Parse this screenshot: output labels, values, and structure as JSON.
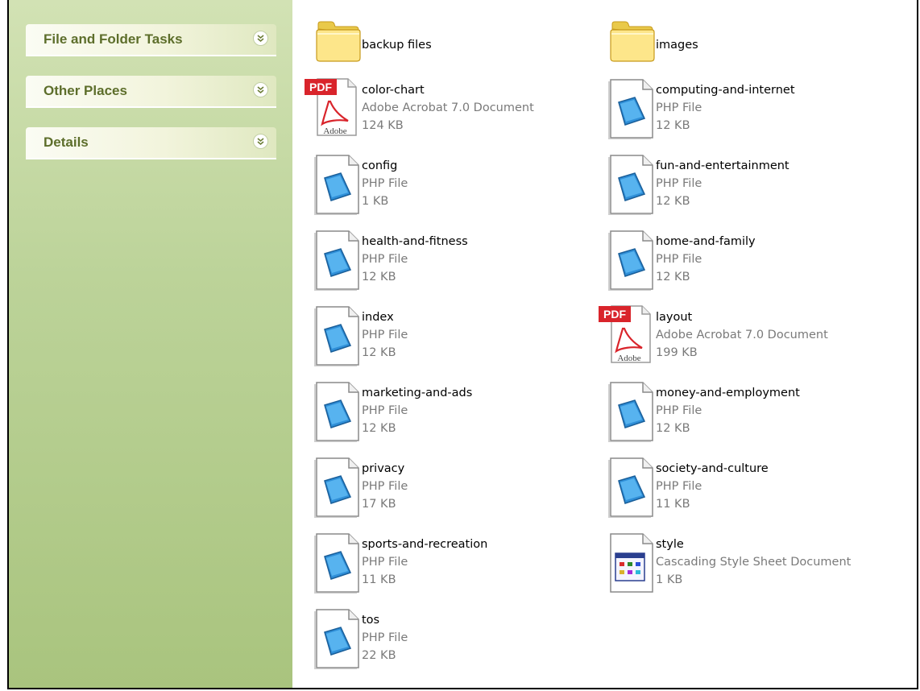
{
  "taskpane": {
    "panels": [
      {
        "label": "File and Folder Tasks"
      },
      {
        "label": "Other Places"
      },
      {
        "label": "Details"
      }
    ]
  },
  "colors": {
    "pane_top": "#d2e2b4",
    "pane_bottom": "#a9c47e",
    "panel_text": "#5d6e2b",
    "meta_text": "#7a7a7a"
  },
  "items": [
    {
      "name": "backup files",
      "icon": "folder-icon"
    },
    {
      "name": "images",
      "icon": "folder-icon"
    },
    {
      "name": "color-chart",
      "type": "Adobe Acrobat 7.0 Document",
      "size": "124 KB",
      "icon": "pdf-icon"
    },
    {
      "name": "computing-and-internet",
      "type": "PHP File",
      "size": "12 KB",
      "icon": "php-file-icon"
    },
    {
      "name": "config",
      "type": "PHP File",
      "size": "1 KB",
      "icon": "php-file-icon"
    },
    {
      "name": "fun-and-entertainment",
      "type": "PHP File",
      "size": "12 KB",
      "icon": "php-file-icon"
    },
    {
      "name": "health-and-fitness",
      "type": "PHP File",
      "size": "12 KB",
      "icon": "php-file-icon"
    },
    {
      "name": "home-and-family",
      "type": "PHP File",
      "size": "12 KB",
      "icon": "php-file-icon"
    },
    {
      "name": "index",
      "type": "PHP File",
      "size": "12 KB",
      "icon": "php-file-icon"
    },
    {
      "name": "layout",
      "type": "Adobe Acrobat 7.0 Document",
      "size": "199 KB",
      "icon": "pdf-icon"
    },
    {
      "name": "marketing-and-ads",
      "type": "PHP File",
      "size": "12 KB",
      "icon": "php-file-icon"
    },
    {
      "name": "money-and-employment",
      "type": "PHP File",
      "size": "12 KB",
      "icon": "php-file-icon"
    },
    {
      "name": "privacy",
      "type": "PHP File",
      "size": "17 KB",
      "icon": "php-file-icon"
    },
    {
      "name": "society-and-culture",
      "type": "PHP File",
      "size": "11 KB",
      "icon": "php-file-icon"
    },
    {
      "name": "sports-and-recreation",
      "type": "PHP File",
      "size": "11 KB",
      "icon": "php-file-icon"
    },
    {
      "name": "style",
      "type": "Cascading Style Sheet Document",
      "size": "1 KB",
      "icon": "css-file-icon"
    },
    {
      "name": "tos",
      "type": "PHP File",
      "size": "22 KB",
      "icon": "php-file-icon"
    }
  ]
}
